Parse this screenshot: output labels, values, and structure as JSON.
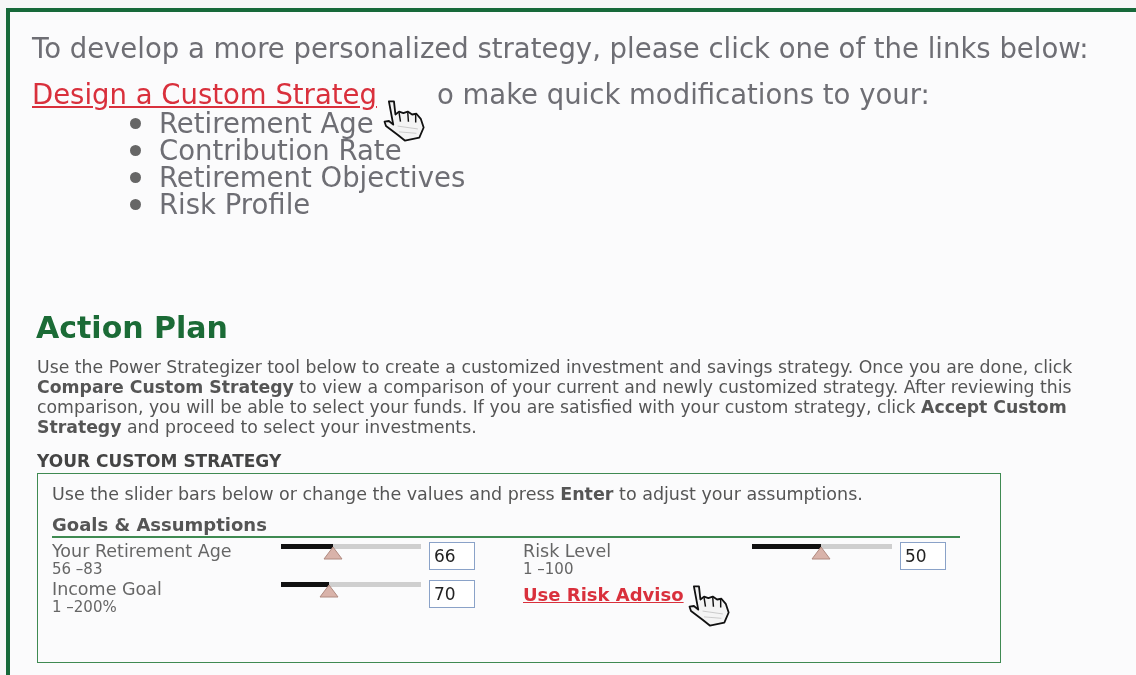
{
  "intro": "To develop a more personalized strategy, please click one of the links below:",
  "design_link": "Design a Custom Strateg",
  "design_text": "o make quick modifications to your:",
  "modifications": [
    "Retirement Age",
    "Contribution Rate",
    "Retirement Objectives",
    "Risk Profile"
  ],
  "action_plan": {
    "title": "Action Plan",
    "description": "Use the Power Strategizer tool below to create a customized investment and savings strategy. Once you are done, click **Compare Custom Strategy** to view a comparison of your current and newly customized strategy. After reviewing this comparison, you will be able to select your funds. If you are satisfied with your custom strategy, click **Accept Custom Strategy** and proceed to select your investments."
  },
  "custom_strategy": {
    "heading": "YOUR CUSTOM STRATEGY",
    "instructions": "Use the slider bars below or change the values and press **Enter** to adjust your assumptions.",
    "section": "Goals & Assumptions",
    "left_sliders": [
      {
        "label": "Your Retirement Age",
        "range": "56 –83",
        "level": 0.37,
        "value": "66"
      },
      {
        "label": "Income Goal",
        "range": "1 –200%",
        "level": 0.34,
        "value": "70"
      }
    ],
    "right_sliders": [
      {
        "label": "Risk Level",
        "range": "1 –100",
        "level": 0.49,
        "value": "50"
      }
    ],
    "risk_link": "Use Risk Adviso"
  }
}
